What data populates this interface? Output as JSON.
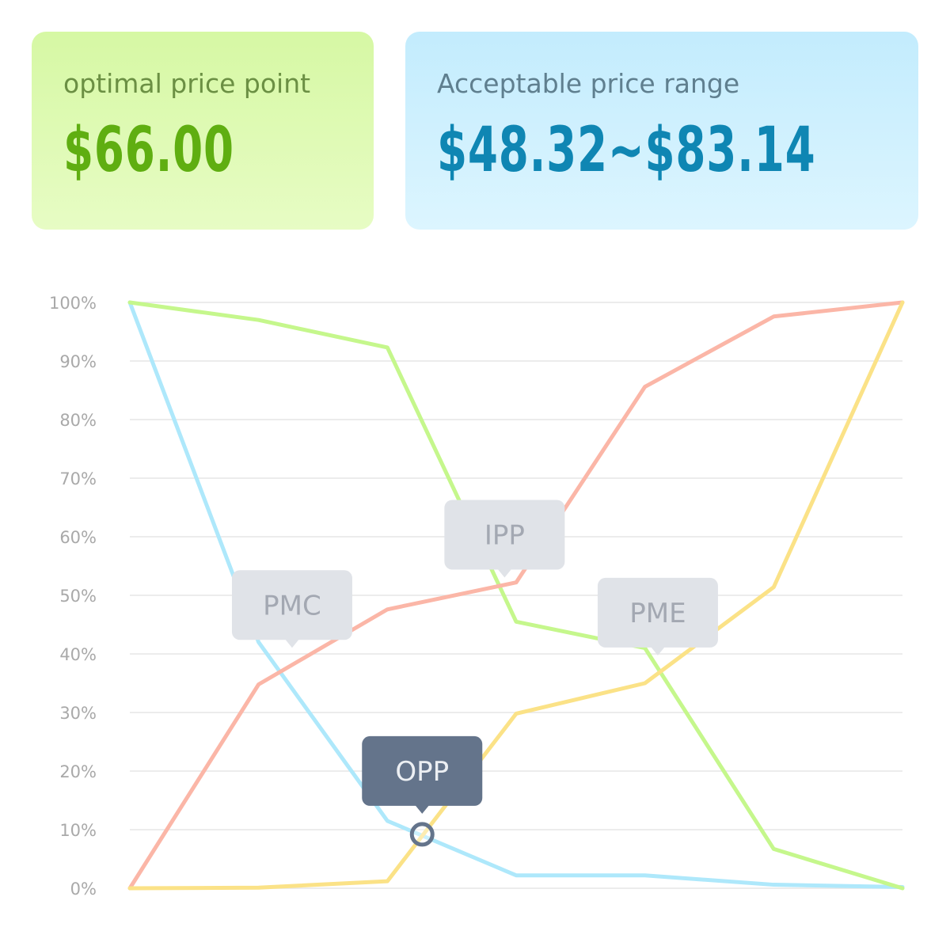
{
  "summary": {
    "optimal": {
      "label": "optimal price point",
      "value": "$66.00"
    },
    "range": {
      "label": "Acceptable price range",
      "value": "$48.32~$83.14"
    }
  },
  "chart_data": {
    "type": "line",
    "x": [
      0,
      1,
      2,
      3,
      4,
      5,
      6
    ],
    "ylim": [
      0,
      100
    ],
    "yticks": [
      "0%",
      "10%",
      "20%",
      "30%",
      "40%",
      "50%",
      "60%",
      "70%",
      "80%",
      "90%",
      "100%"
    ],
    "grid": true,
    "series": [
      {
        "color": "#aee8fb",
        "values": [
          100,
          42,
          11.5,
          2.2,
          2.2,
          0.6,
          0.2
        ]
      },
      {
        "color": "#c5f78c",
        "values": [
          100,
          97,
          92.3,
          45.5,
          41,
          6.7,
          0
        ]
      },
      {
        "color": "#fbb6a7",
        "values": [
          0,
          34.8,
          47.6,
          52.2,
          85.6,
          97.6,
          100
        ]
      },
      {
        "color": "#fbe287",
        "values": [
          0,
          0.1,
          1.2,
          29.8,
          35,
          51.4,
          100
        ]
      }
    ],
    "annotations": [
      {
        "label": "PMC",
        "x": 1.26,
        "y": 40.5,
        "highlight": false
      },
      {
        "label": "IPP",
        "x": 2.91,
        "y": 52.5,
        "highlight": false
      },
      {
        "label": "PME",
        "x": 4.1,
        "y": 39.2,
        "highlight": false
      },
      {
        "label": "OPP",
        "x": 2.27,
        "y": 9.2,
        "highlight": true
      }
    ],
    "colors": {
      "grid": "#e6e6e6",
      "bubble": "#e0e3e8",
      "bubble_text": "#a3a8b2",
      "bubble_highlight": "#64748b",
      "bubble_highlight_text": "#eceff3"
    }
  }
}
